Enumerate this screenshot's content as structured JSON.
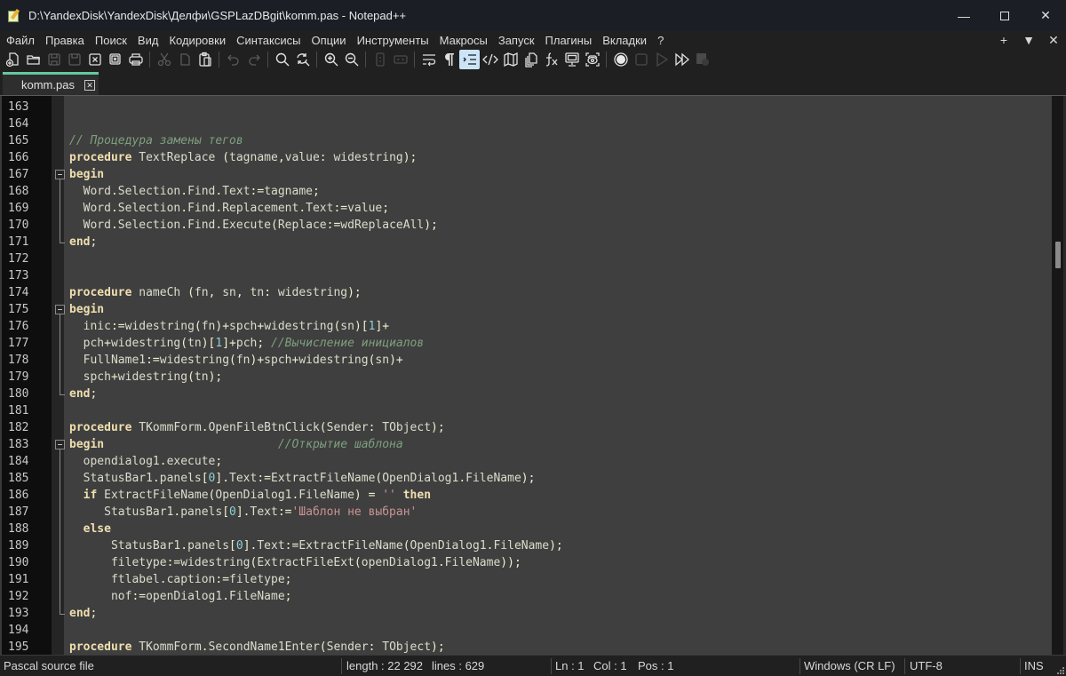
{
  "window": {
    "title": "D:\\YandexDisk\\YandexDisk\\Делфи\\GSPLazDBgit\\komm.pas - Notepad++",
    "controls": {
      "minimize": "—",
      "maximize": "☐",
      "close": "✕"
    }
  },
  "menu": {
    "items": [
      "Файл",
      "Правка",
      "Поиск",
      "Вид",
      "Кодировки",
      "Синтаксисы",
      "Опции",
      "Инструменты",
      "Макросы",
      "Запуск",
      "Плагины",
      "Вкладки",
      "?"
    ],
    "right": {
      "add": "+",
      "list": "▼",
      "close": "✕"
    }
  },
  "toolbar": {
    "buttons": [
      "new-file",
      "open-file",
      "save",
      "save-all",
      "close",
      "close-all",
      "print",
      "|",
      "cut",
      "copy",
      "paste",
      "|",
      "undo",
      "redo",
      "|",
      "find",
      "replace",
      "|",
      "zoom-in",
      "zoom-out",
      "|",
      "sync-vertical",
      "sync-horizontal",
      "|",
      "word-wrap",
      "show-all-chars",
      "indent-guide",
      "xml-tags",
      "document-map",
      "document-list",
      "function-list",
      "monitoring",
      "folder-as-workspace",
      "|",
      "macro-record",
      "macro-stop",
      "macro-play",
      "macro-run-multiple",
      "macro-save"
    ],
    "active": "indent-guide"
  },
  "tabs": [
    {
      "label": "komm.pas",
      "active": true,
      "close": "✕"
    }
  ],
  "editor": {
    "lines": [
      {
        "n": "163",
        "tokens": []
      },
      {
        "n": "164",
        "tokens": []
      },
      {
        "n": "165",
        "tokens": [
          [
            "cm",
            "// Процедура замены тегов"
          ]
        ]
      },
      {
        "n": "166",
        "tokens": [
          [
            "kw",
            "procedure"
          ],
          [
            "",
            " TextReplace "
          ],
          [
            "op",
            "("
          ],
          [
            "",
            "tagname"
          ],
          [
            "op",
            ","
          ],
          [
            "",
            "value"
          ],
          [
            "op",
            ":"
          ],
          [
            "",
            " widestring"
          ],
          [
            "op",
            ");"
          ]
        ]
      },
      {
        "n": "167",
        "tokens": [
          [
            "kw",
            "begin"
          ]
        ]
      },
      {
        "n": "168",
        "tokens": [
          [
            "",
            "  Word"
          ],
          [
            "op",
            "."
          ],
          [
            "",
            "Selection"
          ],
          [
            "op",
            "."
          ],
          [
            "",
            "Find"
          ],
          [
            "op",
            "."
          ],
          [
            "",
            "Text"
          ],
          [
            "op",
            ":="
          ],
          [
            "",
            "tagname"
          ],
          [
            "op",
            ";"
          ]
        ]
      },
      {
        "n": "169",
        "tokens": [
          [
            "",
            "  Word"
          ],
          [
            "op",
            "."
          ],
          [
            "",
            "Selection"
          ],
          [
            "op",
            "."
          ],
          [
            "",
            "Find"
          ],
          [
            "op",
            "."
          ],
          [
            "",
            "Replacement"
          ],
          [
            "op",
            "."
          ],
          [
            "",
            "Text"
          ],
          [
            "op",
            ":="
          ],
          [
            "",
            "value"
          ],
          [
            "op",
            ";"
          ]
        ]
      },
      {
        "n": "170",
        "tokens": [
          [
            "",
            "  Word"
          ],
          [
            "op",
            "."
          ],
          [
            "",
            "Selection"
          ],
          [
            "op",
            "."
          ],
          [
            "",
            "Find"
          ],
          [
            "op",
            "."
          ],
          [
            "",
            "Execute"
          ],
          [
            "op",
            "("
          ],
          [
            "",
            "Replace"
          ],
          [
            "op",
            ":="
          ],
          [
            "",
            "wdReplaceAll"
          ],
          [
            "op",
            ");"
          ]
        ]
      },
      {
        "n": "171",
        "tokens": [
          [
            "kw",
            "end"
          ],
          [
            "op",
            ";"
          ]
        ]
      },
      {
        "n": "172",
        "tokens": []
      },
      {
        "n": "173",
        "tokens": []
      },
      {
        "n": "174",
        "tokens": [
          [
            "kw",
            "procedure"
          ],
          [
            "",
            " nameCh "
          ],
          [
            "op",
            "("
          ],
          [
            "",
            "fn"
          ],
          [
            "op",
            ","
          ],
          [
            "",
            " sn"
          ],
          [
            "op",
            ","
          ],
          [
            "",
            " tn"
          ],
          [
            "op",
            ":"
          ],
          [
            "",
            " widestring"
          ],
          [
            "op",
            ");"
          ]
        ]
      },
      {
        "n": "175",
        "tokens": [
          [
            "kw",
            "begin"
          ]
        ]
      },
      {
        "n": "176",
        "tokens": [
          [
            "",
            "  inic"
          ],
          [
            "op",
            ":="
          ],
          [
            "",
            "widestring"
          ],
          [
            "op",
            "("
          ],
          [
            "",
            "fn"
          ],
          [
            "op",
            ")+"
          ],
          [
            "",
            "spch"
          ],
          [
            "op",
            "+"
          ],
          [
            "",
            "widestring"
          ],
          [
            "op",
            "("
          ],
          [
            "",
            "sn"
          ],
          [
            "op",
            ")["
          ],
          [
            "num",
            "1"
          ],
          [
            "op",
            "]+"
          ]
        ]
      },
      {
        "n": "177",
        "tokens": [
          [
            "",
            "  pch"
          ],
          [
            "op",
            "+"
          ],
          [
            "",
            "widestring"
          ],
          [
            "op",
            "("
          ],
          [
            "",
            "tn"
          ],
          [
            "op",
            ")["
          ],
          [
            "num",
            "1"
          ],
          [
            "op",
            "]+"
          ],
          [
            "",
            "pch"
          ],
          [
            "op",
            ";"
          ],
          [
            "",
            " "
          ],
          [
            "cm",
            "//Вычисление инициалов"
          ]
        ]
      },
      {
        "n": "178",
        "tokens": [
          [
            "",
            "  FullName1"
          ],
          [
            "op",
            ":="
          ],
          [
            "",
            "widestring"
          ],
          [
            "op",
            "("
          ],
          [
            "",
            "fn"
          ],
          [
            "op",
            ")+"
          ],
          [
            "",
            "spch"
          ],
          [
            "op",
            "+"
          ],
          [
            "",
            "widestring"
          ],
          [
            "op",
            "("
          ],
          [
            "",
            "sn"
          ],
          [
            "op",
            ")+"
          ]
        ]
      },
      {
        "n": "179",
        "tokens": [
          [
            "",
            "  spch"
          ],
          [
            "op",
            "+"
          ],
          [
            "",
            "widestring"
          ],
          [
            "op",
            "("
          ],
          [
            "",
            "tn"
          ],
          [
            "op",
            ");"
          ]
        ]
      },
      {
        "n": "180",
        "tokens": [
          [
            "kw",
            "end"
          ],
          [
            "op",
            ";"
          ]
        ]
      },
      {
        "n": "181",
        "tokens": []
      },
      {
        "n": "182",
        "tokens": [
          [
            "kw",
            "procedure"
          ],
          [
            "",
            " TKommForm"
          ],
          [
            "op",
            "."
          ],
          [
            "",
            "OpenFileBtnClick"
          ],
          [
            "op",
            "("
          ],
          [
            "",
            "Sender"
          ],
          [
            "op",
            ":"
          ],
          [
            "",
            " TObject"
          ],
          [
            "op",
            ");"
          ]
        ]
      },
      {
        "n": "183",
        "tokens": [
          [
            "kw",
            "begin"
          ],
          [
            "",
            "                         "
          ],
          [
            "cm",
            "//Открытие шаблона"
          ]
        ]
      },
      {
        "n": "184",
        "tokens": [
          [
            "",
            "  opendialog1"
          ],
          [
            "op",
            "."
          ],
          [
            "",
            "execute"
          ],
          [
            "op",
            ";"
          ]
        ]
      },
      {
        "n": "185",
        "tokens": [
          [
            "",
            "  StatusBar1"
          ],
          [
            "op",
            "."
          ],
          [
            "",
            "panels"
          ],
          [
            "op",
            "["
          ],
          [
            "num",
            "0"
          ],
          [
            "op",
            "]."
          ],
          [
            "",
            "Text"
          ],
          [
            "op",
            ":="
          ],
          [
            "",
            "ExtractFileName"
          ],
          [
            "op",
            "("
          ],
          [
            "",
            "OpenDialog1"
          ],
          [
            "op",
            "."
          ],
          [
            "",
            "FileName"
          ],
          [
            "op",
            ");"
          ]
        ]
      },
      {
        "n": "186",
        "tokens": [
          [
            "",
            "  "
          ],
          [
            "kw",
            "if"
          ],
          [
            "",
            " ExtractFileName"
          ],
          [
            "op",
            "("
          ],
          [
            "",
            "OpenDialog1"
          ],
          [
            "op",
            "."
          ],
          [
            "",
            "FileName"
          ],
          [
            "op",
            ")"
          ],
          [
            "",
            " "
          ],
          [
            "op",
            "="
          ],
          [
            "",
            " "
          ],
          [
            "str",
            "''"
          ],
          [
            "",
            " "
          ],
          [
            "kw",
            "then"
          ]
        ]
      },
      {
        "n": "187",
        "tokens": [
          [
            "",
            "     StatusBar1"
          ],
          [
            "op",
            "."
          ],
          [
            "",
            "panels"
          ],
          [
            "op",
            "["
          ],
          [
            "num",
            "0"
          ],
          [
            "op",
            "]."
          ],
          [
            "",
            "Text"
          ],
          [
            "op",
            ":="
          ],
          [
            "str",
            "'Шаблон не выбран'"
          ]
        ]
      },
      {
        "n": "188",
        "tokens": [
          [
            "",
            "  "
          ],
          [
            "kw",
            "else"
          ]
        ]
      },
      {
        "n": "189",
        "tokens": [
          [
            "",
            "      StatusBar1"
          ],
          [
            "op",
            "."
          ],
          [
            "",
            "panels"
          ],
          [
            "op",
            "["
          ],
          [
            "num",
            "0"
          ],
          [
            "op",
            "]."
          ],
          [
            "",
            "Text"
          ],
          [
            "op",
            ":="
          ],
          [
            "",
            "ExtractFileName"
          ],
          [
            "op",
            "("
          ],
          [
            "",
            "OpenDialog1"
          ],
          [
            "op",
            "."
          ],
          [
            "",
            "FileName"
          ],
          [
            "op",
            ");"
          ]
        ]
      },
      {
        "n": "190",
        "tokens": [
          [
            "",
            "      filetype"
          ],
          [
            "op",
            ":="
          ],
          [
            "",
            "widestring"
          ],
          [
            "op",
            "("
          ],
          [
            "",
            "ExtractFileExt"
          ],
          [
            "op",
            "("
          ],
          [
            "",
            "openDialog1"
          ],
          [
            "op",
            "."
          ],
          [
            "",
            "FileName"
          ],
          [
            "op",
            "));"
          ]
        ]
      },
      {
        "n": "191",
        "tokens": [
          [
            "",
            "      ftlabel"
          ],
          [
            "op",
            "."
          ],
          [
            "",
            "caption"
          ],
          [
            "op",
            ":="
          ],
          [
            "",
            "filetype"
          ],
          [
            "op",
            ";"
          ]
        ]
      },
      {
        "n": "192",
        "tokens": [
          [
            "",
            "      nof"
          ],
          [
            "op",
            ":="
          ],
          [
            "",
            "openDialog1"
          ],
          [
            "op",
            "."
          ],
          [
            "",
            "FileName"
          ],
          [
            "op",
            ";"
          ]
        ]
      },
      {
        "n": "193",
        "tokens": [
          [
            "kw",
            "end"
          ],
          [
            "op",
            ";"
          ]
        ]
      },
      {
        "n": "194",
        "tokens": []
      },
      {
        "n": "195",
        "tokens": [
          [
            "kw",
            "procedure"
          ],
          [
            "",
            " TKommForm"
          ],
          [
            "op",
            "."
          ],
          [
            "",
            "SecondName1Enter"
          ],
          [
            "op",
            "("
          ],
          [
            "",
            "Sender"
          ],
          [
            "op",
            ":"
          ],
          [
            "",
            " TObject"
          ],
          [
            "op",
            ");"
          ]
        ]
      }
    ],
    "fold_blocks": [
      {
        "begin": "167",
        "end": "171"
      },
      {
        "begin": "175",
        "end": "180"
      },
      {
        "begin": "183",
        "end": "193"
      }
    ]
  },
  "statusbar": {
    "file_type": "Pascal source file",
    "length": "length : 22 292",
    "lines": "lines : 629",
    "ln": "Ln : 1",
    "col": "Col : 1",
    "pos": "Pos : 1",
    "eol": "Windows (CR LF)",
    "encoding": "UTF-8",
    "mode": "INS"
  }
}
